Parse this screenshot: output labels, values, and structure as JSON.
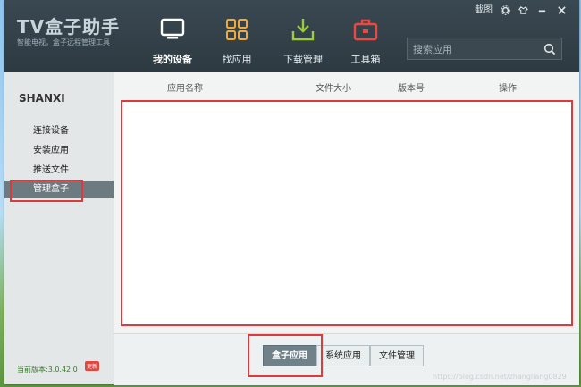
{
  "app": {
    "logo_title": "TV盒子助手",
    "logo_subtitle": "智能电视，盒子远程管理工具"
  },
  "window_controls": {
    "screenshot_label": "截图",
    "settings_icon": "gear-icon",
    "skin_icon": "shirt-icon",
    "minimize_icon": "minimize-icon",
    "close_icon": "close-icon"
  },
  "nav": {
    "items": [
      {
        "label": "我的设备",
        "icon": "monitor-icon",
        "active": true
      },
      {
        "label": "找应用",
        "icon": "grid-icon"
      },
      {
        "label": "下载管理",
        "icon": "download-icon"
      },
      {
        "label": "工具箱",
        "icon": "toolbox-icon"
      }
    ]
  },
  "search": {
    "placeholder": "搜索应用",
    "icon": "search-icon"
  },
  "sidebar": {
    "device_name": "SHANXI",
    "items": [
      {
        "label": "连接设备"
      },
      {
        "label": "安装应用"
      },
      {
        "label": "推送文件"
      },
      {
        "label": "管理盒子",
        "active": true
      }
    ],
    "version_text": "当前版本:3.0.42.0",
    "update_badge": "更新"
  },
  "table": {
    "columns": [
      "应用名称",
      "文件大小",
      "版本号",
      "操作"
    ],
    "rows": []
  },
  "bottom_tabs": [
    {
      "label": "盒子应用",
      "active": true
    },
    {
      "label": "系统应用"
    },
    {
      "label": "文件管理"
    }
  ],
  "watermark": "https://blog.csdn.net/zhangliang0829",
  "colors": {
    "highlight_red": "#e0393c",
    "sidebar_active": "#6d7a80",
    "header_bg": "#2f3d45"
  }
}
